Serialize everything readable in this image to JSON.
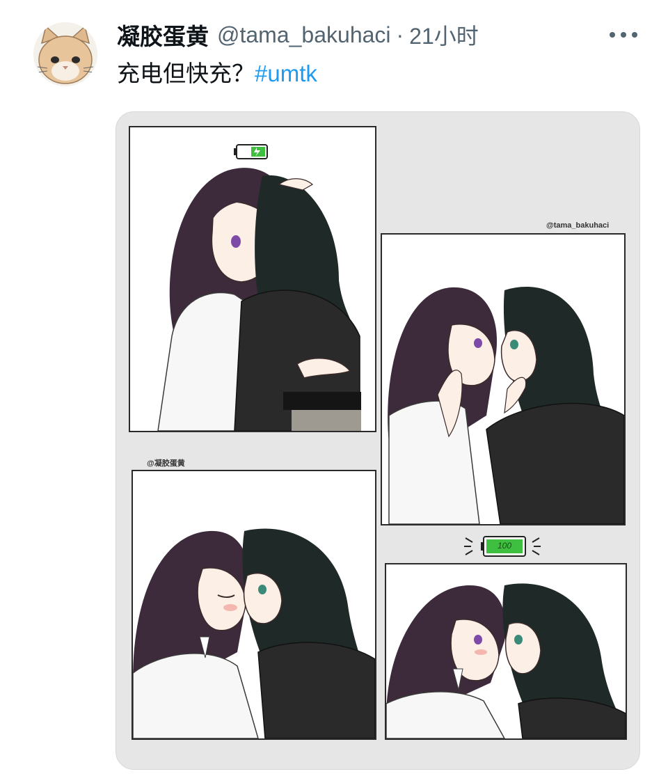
{
  "tweet": {
    "display_name": "凝胶蛋黄",
    "handle": "@tama_bakuhaci",
    "separator": "·",
    "time": "21小时",
    "text_plain": "充电但快充？",
    "hashtag": "#umtk"
  },
  "media": {
    "credit_top": "@tama_bakuhaci",
    "credit_left": "@凝胶蛋黄",
    "battery_full_label": "100"
  },
  "colors": {
    "hashtag": "#1d9bf0",
    "muted": "#536471",
    "battery_green": "#3fbf3f",
    "hair_purple": "#3d2a3b",
    "hair_dark": "#1f2a28"
  },
  "icons": {
    "more": "more-horizontal-icon",
    "battery_charging": "battery-charging-icon",
    "battery_full": "battery-full-icon"
  }
}
